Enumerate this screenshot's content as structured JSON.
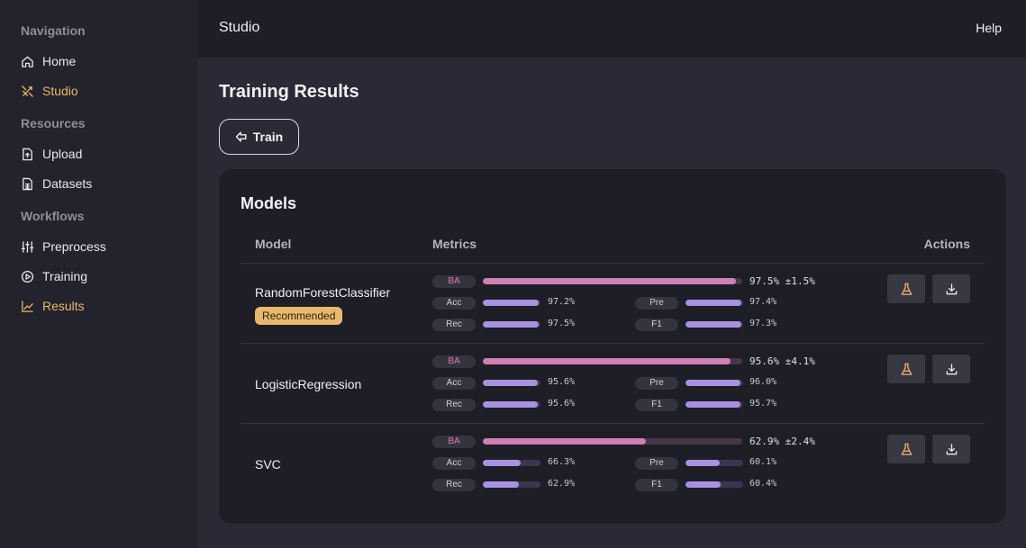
{
  "sidebar": {
    "sections": [
      {
        "title": "Navigation",
        "items": [
          {
            "label": "Home",
            "icon": "home-icon",
            "active": false
          },
          {
            "label": "Studio",
            "icon": "studio-icon",
            "active": true
          }
        ]
      },
      {
        "title": "Resources",
        "items": [
          {
            "label": "Upload",
            "icon": "upload-file-icon",
            "active": false
          },
          {
            "label": "Datasets",
            "icon": "dataset-file-icon",
            "active": false
          }
        ]
      },
      {
        "title": "Workflows",
        "items": [
          {
            "label": "Preprocess",
            "icon": "sliders-icon",
            "active": false
          },
          {
            "label": "Training",
            "icon": "play-circle-icon",
            "active": false
          },
          {
            "label": "Results",
            "icon": "line-chart-icon",
            "active": true
          }
        ]
      }
    ]
  },
  "topbar": {
    "title": "Studio",
    "help_label": "Help"
  },
  "main": {
    "title": "Training Results",
    "train_button": {
      "label": "Train",
      "icon": "arrow-left-icon"
    }
  },
  "models_card": {
    "title": "Models",
    "columns": {
      "model": "Model",
      "metrics": "Metrics",
      "actions": "Actions"
    },
    "rows": [
      {
        "name": "RandomForestClassifier",
        "badge": "Recommended",
        "ba": {
          "label": "BA",
          "value": 97.5,
          "text": "97.5% ±1.5%"
        },
        "metrics": [
          {
            "label": "Acc",
            "value": 97.2,
            "text": "97.2%"
          },
          {
            "label": "Pre",
            "value": 97.4,
            "text": "97.4%"
          },
          {
            "label": "Rec",
            "value": 97.5,
            "text": "97.5%"
          },
          {
            "label": "F1",
            "value": 97.3,
            "text": "97.3%"
          }
        ]
      },
      {
        "name": "LogisticRegression",
        "badge": "",
        "ba": {
          "label": "BA",
          "value": 95.6,
          "text": "95.6% ±4.1%"
        },
        "metrics": [
          {
            "label": "Acc",
            "value": 95.6,
            "text": "95.6%"
          },
          {
            "label": "Pre",
            "value": 96.0,
            "text": "96.0%"
          },
          {
            "label": "Rec",
            "value": 95.6,
            "text": "95.6%"
          },
          {
            "label": "F1",
            "value": 95.7,
            "text": "95.7%"
          }
        ]
      },
      {
        "name": "SVC",
        "badge": "",
        "ba": {
          "label": "BA",
          "value": 62.9,
          "text": "62.9% ±2.4%"
        },
        "metrics": [
          {
            "label": "Acc",
            "value": 66.3,
            "text": "66.3%"
          },
          {
            "label": "Pre",
            "value": 60.1,
            "text": "60.1%"
          },
          {
            "label": "Rec",
            "value": 62.9,
            "text": "62.9%"
          },
          {
            "label": "F1",
            "value": 60.4,
            "text": "60.4%"
          }
        ]
      }
    ],
    "action_icons": [
      "flask-icon",
      "download-icon"
    ]
  },
  "colors": {
    "accent": "#e8b96a",
    "ba_bar": "#d07fb4",
    "metric_bar": "#a892e0"
  }
}
